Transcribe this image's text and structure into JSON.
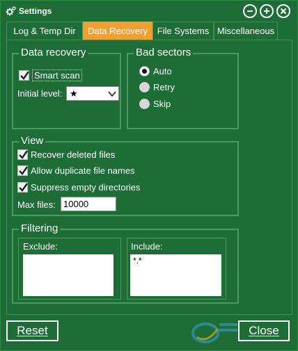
{
  "window": {
    "title": "Settings"
  },
  "tabs": [
    {
      "label": "Log & Temp Dir"
    },
    {
      "label": "Data Recovery"
    },
    {
      "label": "File Systems"
    },
    {
      "label": "Miscellaneous"
    }
  ],
  "data_recovery": {
    "legend": "Data recovery",
    "smart_scan": {
      "label": "Smart scan",
      "checked": true
    },
    "initial_level": {
      "label": "Initial level:",
      "value": "★"
    }
  },
  "bad_sectors": {
    "legend": "Bad sectors",
    "options": [
      {
        "label": "Auto",
        "selected": true
      },
      {
        "label": "Retry",
        "selected": false
      },
      {
        "label": "Skip",
        "selected": false
      }
    ]
  },
  "view": {
    "legend": "View",
    "recover_deleted": {
      "label": "Recover deleted files",
      "checked": true
    },
    "allow_duplicate": {
      "label": "Allow duplicate file names",
      "checked": true
    },
    "suppress_empty": {
      "label": "Suppress empty directories",
      "checked": true
    },
    "max_files": {
      "label": "Max files:",
      "value": "10000"
    }
  },
  "filtering": {
    "legend": "Filtering",
    "exclude": {
      "label": "Exclude:",
      "value": ""
    },
    "include": {
      "label": "Include:",
      "value": "*.*"
    }
  },
  "buttons": {
    "reset": "Reset",
    "close": "Close"
  },
  "colors": {
    "background": "#1f6d36",
    "tab_active": "#f0a030",
    "border": "#4c9a60"
  }
}
